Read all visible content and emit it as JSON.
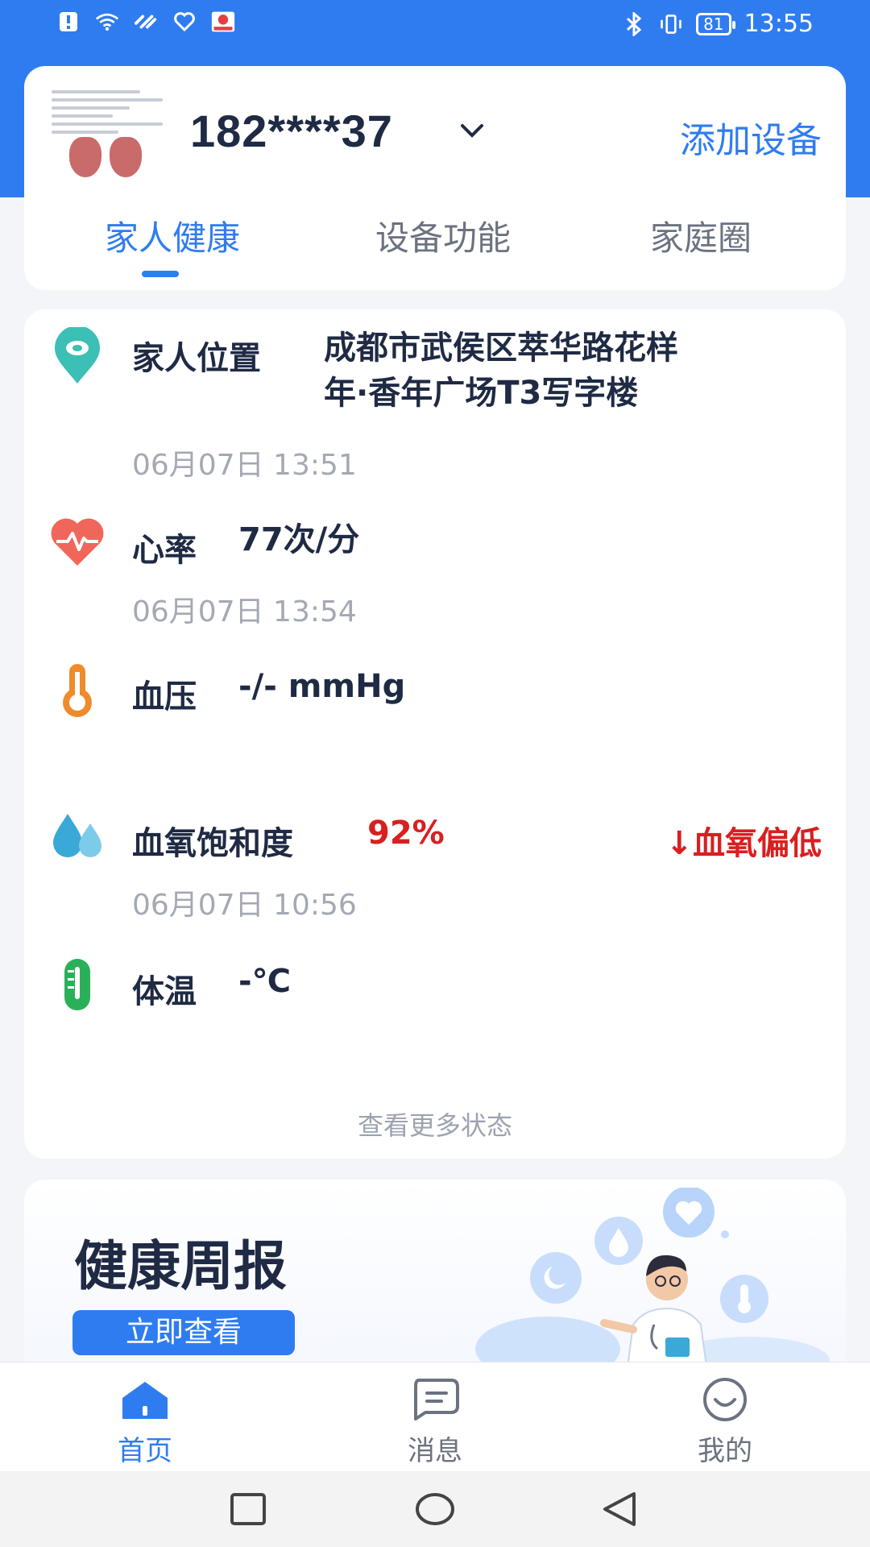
{
  "status_bar": {
    "time": "13:55",
    "battery": "81"
  },
  "profile": {
    "phone": "182****37",
    "add_device": "添加设备"
  },
  "tabs": [
    {
      "label": "家人健康",
      "active": true
    },
    {
      "label": "设备功能",
      "active": false
    },
    {
      "label": "家庭圈",
      "active": false
    }
  ],
  "health": {
    "location": {
      "title": "家人位置",
      "value_line1": "成都市武侯区萃华路花样",
      "value_line2": "年·香年广场T3写字楼",
      "time": "06月07日 13:51"
    },
    "heart_rate": {
      "title": "心率",
      "value": "77次/分",
      "time": "06月07日 13:54"
    },
    "blood_pressure": {
      "title": "血压",
      "value": "-/- mmHg"
    },
    "blood_oxygen": {
      "title": "血氧饱和度",
      "value": "92%",
      "alert": "↓血氧偏低",
      "time": "06月07日 10:56"
    },
    "temperature": {
      "title": "体温",
      "value": "-℃"
    },
    "more": "查看更多状态"
  },
  "report": {
    "title": "健康周报",
    "button": "立即查看"
  },
  "bottom_nav": [
    {
      "label": "首页",
      "icon": "home-icon",
      "active": true
    },
    {
      "label": "消息",
      "icon": "message-icon",
      "active": false
    },
    {
      "label": "我的",
      "icon": "smile-icon",
      "active": false
    }
  ],
  "colors": {
    "brand": "#2f7cf0",
    "alert": "#d91f1f",
    "location": "#3cbfb4",
    "heart": "#f0665a",
    "pressure": "#f08a2a",
    "oxygen": "#3aa9d8",
    "temperature": "#2bb05a"
  }
}
